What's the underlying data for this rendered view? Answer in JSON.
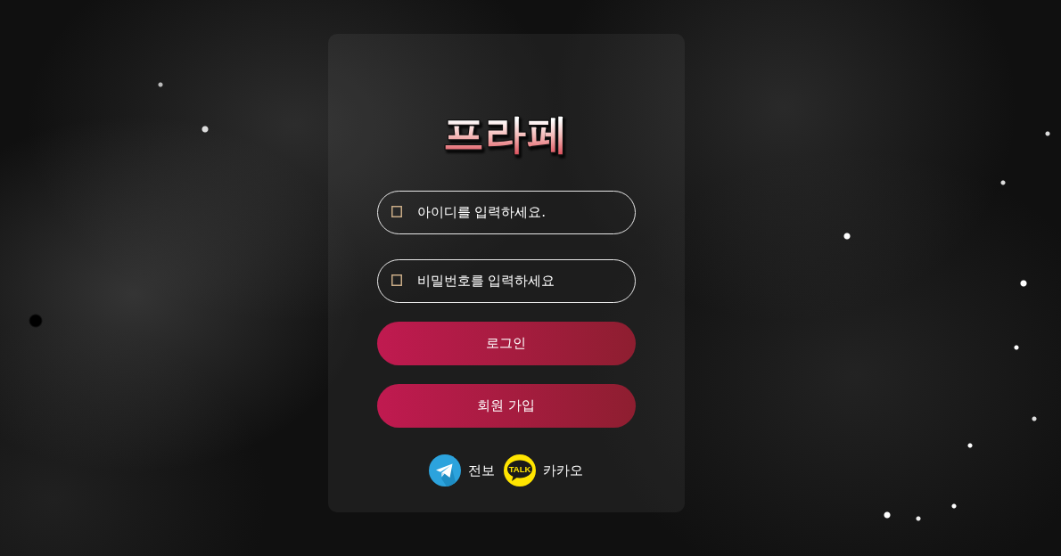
{
  "logo": "프라페",
  "fields": [
    {
      "placeholder": "아이디를 입력하세요."
    },
    {
      "placeholder": "비밀번호를 입력하세요"
    }
  ],
  "buttons": [
    "로그인",
    "회원 가입"
  ],
  "social_links": [
    {
      "kind": "telegram",
      "label": "전보"
    },
    {
      "kind": "kakao",
      "label": "카카오",
      "icon_text": "TALK"
    }
  ]
}
